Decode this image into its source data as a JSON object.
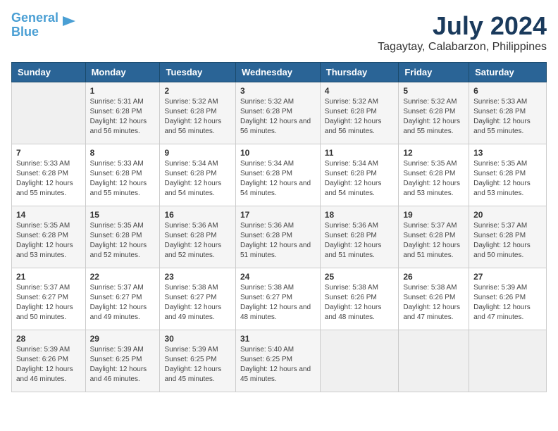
{
  "header": {
    "logo_line1": "General",
    "logo_line2": "Blue",
    "title": "July 2024",
    "subtitle": "Tagaytay, Calabarzon, Philippines"
  },
  "weekdays": [
    "Sunday",
    "Monday",
    "Tuesday",
    "Wednesday",
    "Thursday",
    "Friday",
    "Saturday"
  ],
  "weeks": [
    [
      {
        "day": "",
        "sunrise": "",
        "sunset": "",
        "daylight": ""
      },
      {
        "day": "1",
        "sunrise": "Sunrise: 5:31 AM",
        "sunset": "Sunset: 6:28 PM",
        "daylight": "Daylight: 12 hours and 56 minutes."
      },
      {
        "day": "2",
        "sunrise": "Sunrise: 5:32 AM",
        "sunset": "Sunset: 6:28 PM",
        "daylight": "Daylight: 12 hours and 56 minutes."
      },
      {
        "day": "3",
        "sunrise": "Sunrise: 5:32 AM",
        "sunset": "Sunset: 6:28 PM",
        "daylight": "Daylight: 12 hours and 56 minutes."
      },
      {
        "day": "4",
        "sunrise": "Sunrise: 5:32 AM",
        "sunset": "Sunset: 6:28 PM",
        "daylight": "Daylight: 12 hours and 56 minutes."
      },
      {
        "day": "5",
        "sunrise": "Sunrise: 5:32 AM",
        "sunset": "Sunset: 6:28 PM",
        "daylight": "Daylight: 12 hours and 55 minutes."
      },
      {
        "day": "6",
        "sunrise": "Sunrise: 5:33 AM",
        "sunset": "Sunset: 6:28 PM",
        "daylight": "Daylight: 12 hours and 55 minutes."
      }
    ],
    [
      {
        "day": "7",
        "sunrise": "Sunrise: 5:33 AM",
        "sunset": "Sunset: 6:28 PM",
        "daylight": "Daylight: 12 hours and 55 minutes."
      },
      {
        "day": "8",
        "sunrise": "Sunrise: 5:33 AM",
        "sunset": "Sunset: 6:28 PM",
        "daylight": "Daylight: 12 hours and 55 minutes."
      },
      {
        "day": "9",
        "sunrise": "Sunrise: 5:34 AM",
        "sunset": "Sunset: 6:28 PM",
        "daylight": "Daylight: 12 hours and 54 minutes."
      },
      {
        "day": "10",
        "sunrise": "Sunrise: 5:34 AM",
        "sunset": "Sunset: 6:28 PM",
        "daylight": "Daylight: 12 hours and 54 minutes."
      },
      {
        "day": "11",
        "sunrise": "Sunrise: 5:34 AM",
        "sunset": "Sunset: 6:28 PM",
        "daylight": "Daylight: 12 hours and 54 minutes."
      },
      {
        "day": "12",
        "sunrise": "Sunrise: 5:35 AM",
        "sunset": "Sunset: 6:28 PM",
        "daylight": "Daylight: 12 hours and 53 minutes."
      },
      {
        "day": "13",
        "sunrise": "Sunrise: 5:35 AM",
        "sunset": "Sunset: 6:28 PM",
        "daylight": "Daylight: 12 hours and 53 minutes."
      }
    ],
    [
      {
        "day": "14",
        "sunrise": "Sunrise: 5:35 AM",
        "sunset": "Sunset: 6:28 PM",
        "daylight": "Daylight: 12 hours and 53 minutes."
      },
      {
        "day": "15",
        "sunrise": "Sunrise: 5:35 AM",
        "sunset": "Sunset: 6:28 PM",
        "daylight": "Daylight: 12 hours and 52 minutes."
      },
      {
        "day": "16",
        "sunrise": "Sunrise: 5:36 AM",
        "sunset": "Sunset: 6:28 PM",
        "daylight": "Daylight: 12 hours and 52 minutes."
      },
      {
        "day": "17",
        "sunrise": "Sunrise: 5:36 AM",
        "sunset": "Sunset: 6:28 PM",
        "daylight": "Daylight: 12 hours and 51 minutes."
      },
      {
        "day": "18",
        "sunrise": "Sunrise: 5:36 AM",
        "sunset": "Sunset: 6:28 PM",
        "daylight": "Daylight: 12 hours and 51 minutes."
      },
      {
        "day": "19",
        "sunrise": "Sunrise: 5:37 AM",
        "sunset": "Sunset: 6:28 PM",
        "daylight": "Daylight: 12 hours and 51 minutes."
      },
      {
        "day": "20",
        "sunrise": "Sunrise: 5:37 AM",
        "sunset": "Sunset: 6:28 PM",
        "daylight": "Daylight: 12 hours and 50 minutes."
      }
    ],
    [
      {
        "day": "21",
        "sunrise": "Sunrise: 5:37 AM",
        "sunset": "Sunset: 6:27 PM",
        "daylight": "Daylight: 12 hours and 50 minutes."
      },
      {
        "day": "22",
        "sunrise": "Sunrise: 5:37 AM",
        "sunset": "Sunset: 6:27 PM",
        "daylight": "Daylight: 12 hours and 49 minutes."
      },
      {
        "day": "23",
        "sunrise": "Sunrise: 5:38 AM",
        "sunset": "Sunset: 6:27 PM",
        "daylight": "Daylight: 12 hours and 49 minutes."
      },
      {
        "day": "24",
        "sunrise": "Sunrise: 5:38 AM",
        "sunset": "Sunset: 6:27 PM",
        "daylight": "Daylight: 12 hours and 48 minutes."
      },
      {
        "day": "25",
        "sunrise": "Sunrise: 5:38 AM",
        "sunset": "Sunset: 6:26 PM",
        "daylight": "Daylight: 12 hours and 48 minutes."
      },
      {
        "day": "26",
        "sunrise": "Sunrise: 5:38 AM",
        "sunset": "Sunset: 6:26 PM",
        "daylight": "Daylight: 12 hours and 47 minutes."
      },
      {
        "day": "27",
        "sunrise": "Sunrise: 5:39 AM",
        "sunset": "Sunset: 6:26 PM",
        "daylight": "Daylight: 12 hours and 47 minutes."
      }
    ],
    [
      {
        "day": "28",
        "sunrise": "Sunrise: 5:39 AM",
        "sunset": "Sunset: 6:26 PM",
        "daylight": "Daylight: 12 hours and 46 minutes."
      },
      {
        "day": "29",
        "sunrise": "Sunrise: 5:39 AM",
        "sunset": "Sunset: 6:25 PM",
        "daylight": "Daylight: 12 hours and 46 minutes."
      },
      {
        "day": "30",
        "sunrise": "Sunrise: 5:39 AM",
        "sunset": "Sunset: 6:25 PM",
        "daylight": "Daylight: 12 hours and 45 minutes."
      },
      {
        "day": "31",
        "sunrise": "Sunrise: 5:40 AM",
        "sunset": "Sunset: 6:25 PM",
        "daylight": "Daylight: 12 hours and 45 minutes."
      },
      {
        "day": "",
        "sunrise": "",
        "sunset": "",
        "daylight": ""
      },
      {
        "day": "",
        "sunrise": "",
        "sunset": "",
        "daylight": ""
      },
      {
        "day": "",
        "sunrise": "",
        "sunset": "",
        "daylight": ""
      }
    ]
  ]
}
